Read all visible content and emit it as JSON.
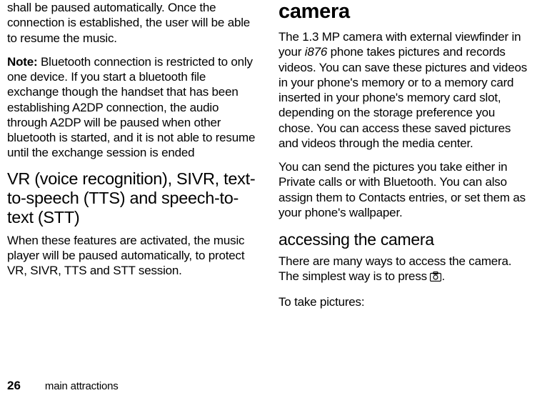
{
  "left": {
    "p1": "shall be paused automatically. Once the connection is established, the user will be able to resume the music.",
    "note_label": "Note:",
    "note_text": " Bluetooth connection is restricted to only one device. If you start a bluetooth file exchange though the handset that has been establishing A2DP connection, the audio through A2DP will be paused when other bluetooth is started, and it is not able to resume until the exchange session is ended",
    "subhead": "VR (voice recognition), SIVR, text-to-speech (TTS) and speech-to-text (STT)",
    "p2": "When these features are activated, the music player will be paused automatically, to protect VR, SIVR, TTS and STT session."
  },
  "right": {
    "heading": "camera",
    "p1_a": "The 1.3 MP camera with external viewfinder in your ",
    "model": "i876",
    "p1_b": " phone takes pictures and records videos. You can save these pictures and videos in your phone's memory or to a memory card inserted in your phone's memory card slot, depending on the storage preference you chose. You can access these saved pictures and videos through the media center.",
    "p2": "You can send the pictures you take either in Private calls or with Bluetooth. You can also assign them to Contacts entries, or set them as your phone's wallpaper.",
    "subheading": "accessing the camera",
    "p3_a": "There are many ways to access the camera. The simplest way is to press ",
    "p3_b": ".",
    "p4": "To take pictures:"
  },
  "footer": {
    "page_number": "26",
    "section": "main attractions"
  }
}
